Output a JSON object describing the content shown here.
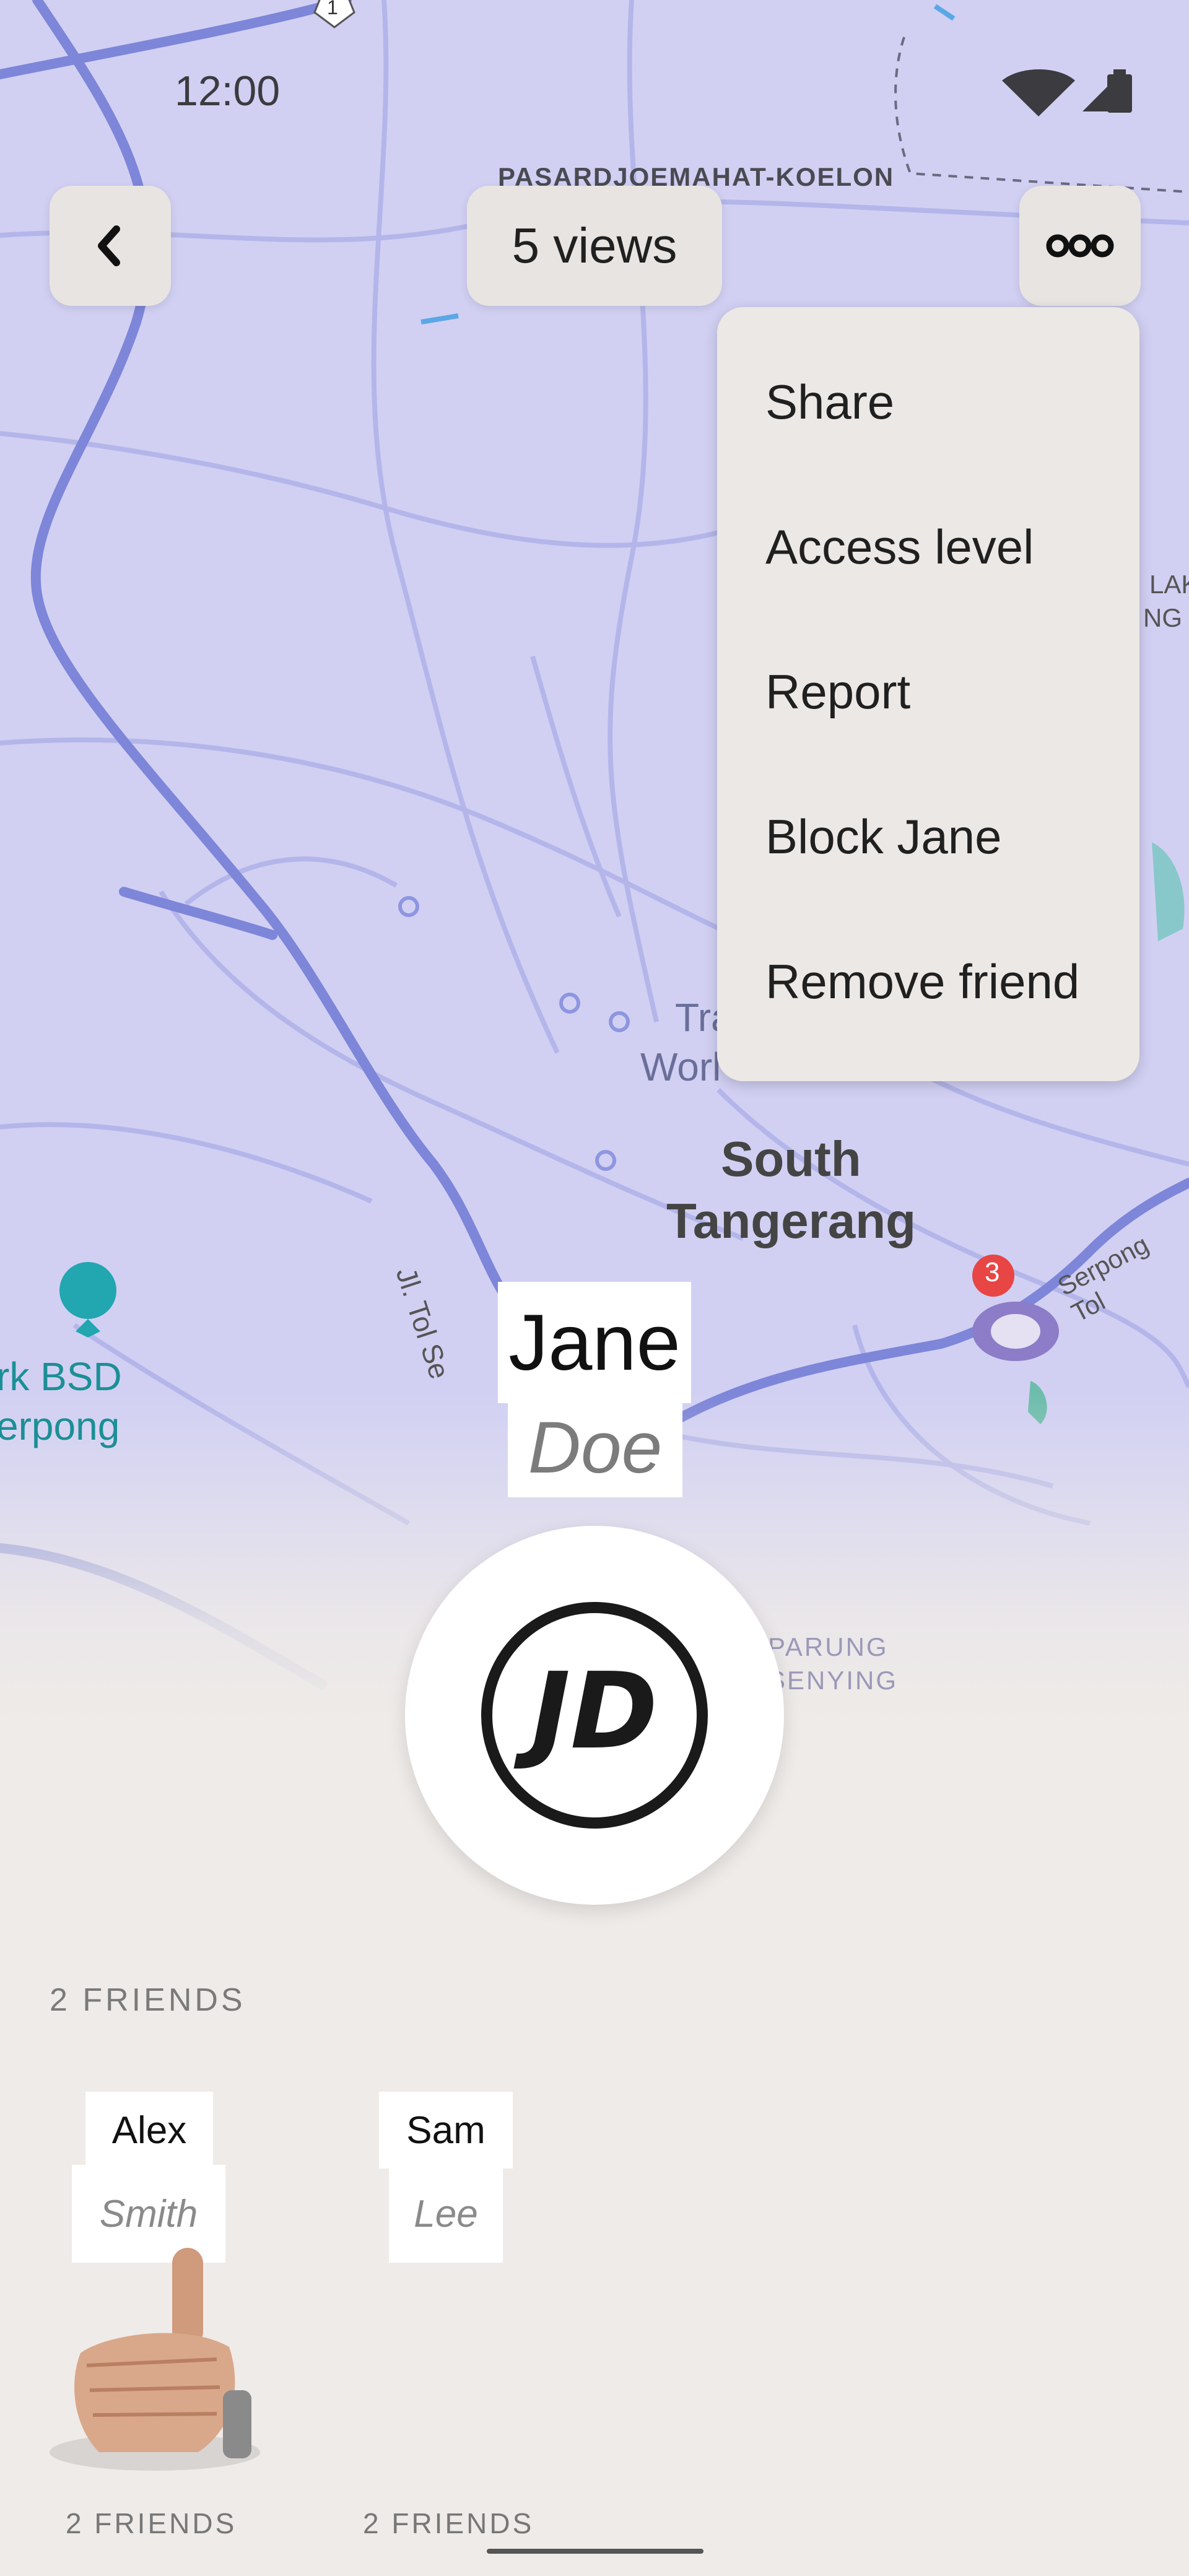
{
  "status_bar": {
    "time": "12:00"
  },
  "header": {
    "views_label": "5 views",
    "back_icon": "chevron-left-icon",
    "more_icon": "more-horizontal-icon"
  },
  "menu": {
    "items": [
      "Share",
      "Access level",
      "Report",
      "Block Jane",
      "Remove friend"
    ]
  },
  "map": {
    "labels": {
      "district_top": "PASARDJOEMAHAT-KOELON",
      "city_line1": "South",
      "city_line2": "Tangerang",
      "park_line1": "rk BSD",
      "park_line2": "erpong",
      "parung_line1": "PARUNG",
      "parung_line2": "SENYING",
      "road_jl": "Jl. Tol Se",
      "road_serpong": "Serpong Tol",
      "edge_lak": "LAK",
      "edge_ng": "NG",
      "tra_partial": "Tra",
      "world_partial": "Worl",
      "road_shield": "1"
    },
    "marker_badge": "3",
    "colors": {
      "base": "#d1d0f3",
      "roads": "#7d86d8",
      "badge": "#e84545"
    }
  },
  "profile": {
    "first_name": "Jane",
    "last_name": "Doe",
    "avatar_monogram": "JD"
  },
  "friends_section": {
    "title": "2 FRIENDS",
    "friends": [
      {
        "first": "Alex",
        "last": "Smith",
        "count": "2 FRIENDS"
      },
      {
        "first": "Sam",
        "last": "Lee",
        "count": "2 FRIENDS"
      }
    ]
  }
}
